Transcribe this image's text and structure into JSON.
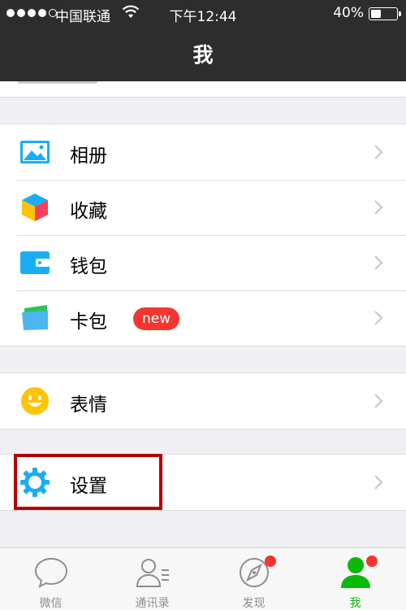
{
  "status_bar": {
    "carrier": "中国联通",
    "time": "下午12:44",
    "battery_text": "40%",
    "battery_level": 0.4
  },
  "nav": {
    "title": "我"
  },
  "menu": {
    "album": {
      "label": "相册",
      "icon": "album-icon"
    },
    "favorites": {
      "label": "收藏",
      "icon": "favorites-cube-icon"
    },
    "wallet": {
      "label": "钱包",
      "icon": "wallet-icon"
    },
    "cards": {
      "label": "卡包",
      "icon": "cards-icon",
      "badge": "new"
    },
    "stickers": {
      "label": "表情",
      "icon": "smiley-icon"
    },
    "settings": {
      "label": "设置",
      "icon": "gear-icon"
    }
  },
  "tabbar": {
    "tabs": [
      {
        "label": "微信",
        "icon": "chat-bubble-icon",
        "active": false,
        "dot": false
      },
      {
        "label": "通讯录",
        "icon": "contacts-icon",
        "active": false,
        "dot": false
      },
      {
        "label": "发现",
        "icon": "compass-icon",
        "active": false,
        "dot": true
      },
      {
        "label": "我",
        "icon": "person-icon",
        "active": true,
        "dot": true
      }
    ]
  },
  "colors": {
    "nav_bg": "#2d2d2e",
    "active_tab": "#09bb07",
    "badge_red": "#f43530",
    "highlight_box": "#b30000",
    "icon_blue": "#1aadf5"
  }
}
